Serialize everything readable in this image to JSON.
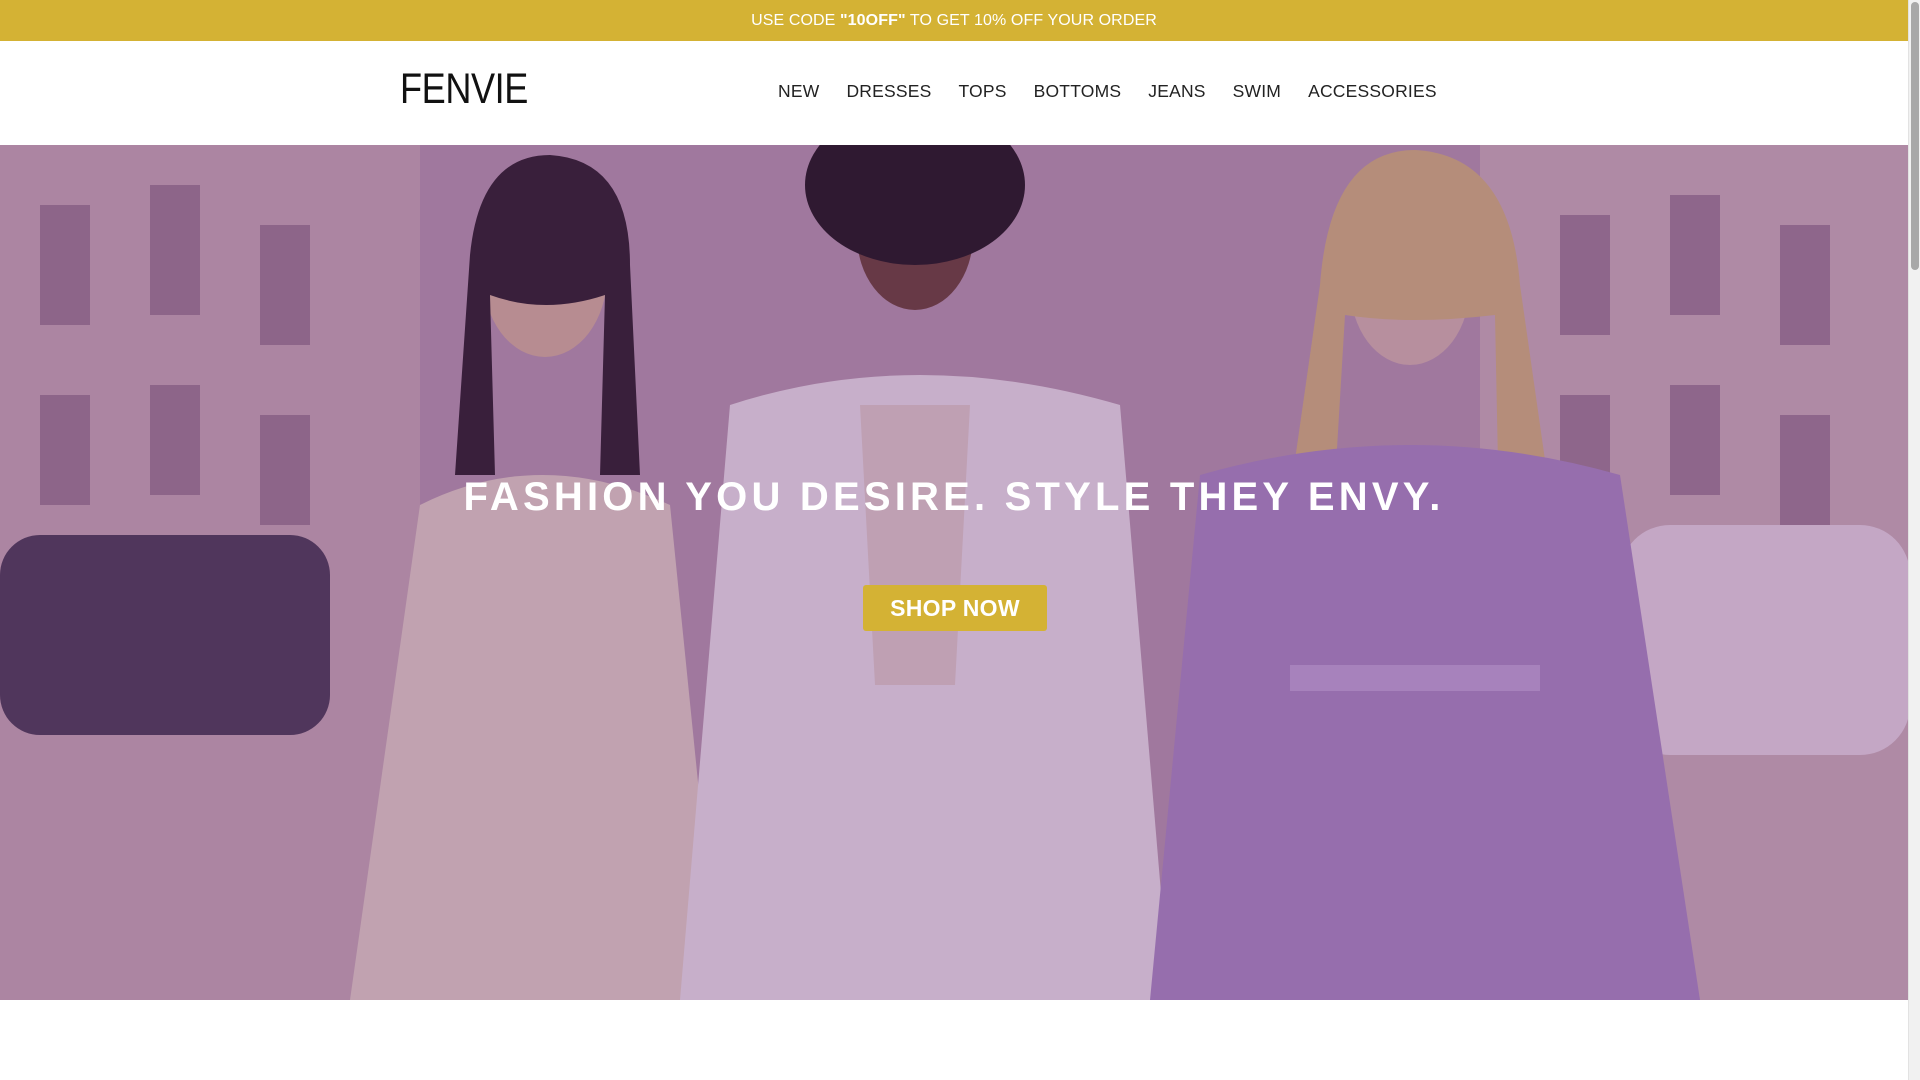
{
  "promo": {
    "prefix": "USE CODE ",
    "code": "\"10OFF\"",
    "suffix": " TO GET 10% OFF YOUR ORDER"
  },
  "header": {
    "logo": "FENVIE",
    "nav": [
      "NEW",
      "DRESSES",
      "TOPS",
      "BOTTOMS",
      "JEANS",
      "SWIM",
      "ACCESSORIES"
    ]
  },
  "hero": {
    "title": "FASHION YOU DESIRE. STYLE THEY ENVY.",
    "cta_label": "SHOP NOW"
  },
  "colors": {
    "accent": "#d4b234",
    "overlay": "#62287a",
    "text_dark": "#222222"
  },
  "icons": [
    "scrollbar-thumb"
  ]
}
